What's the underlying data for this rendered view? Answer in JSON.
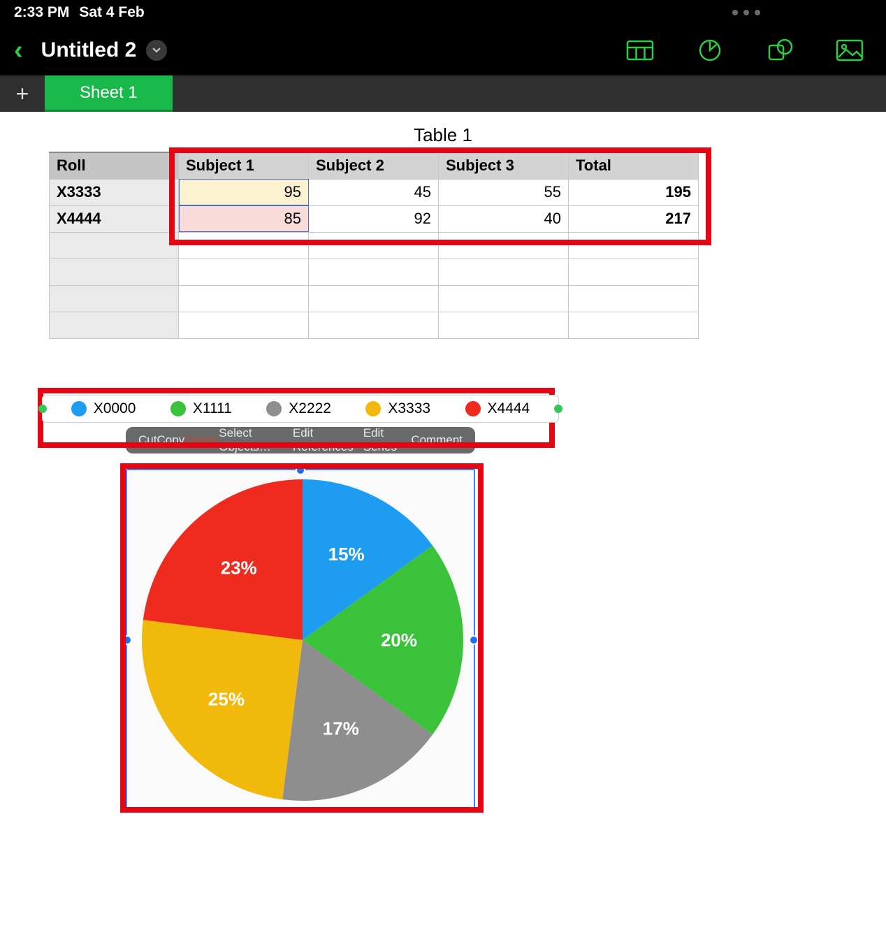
{
  "status": {
    "time": "2:33 PM",
    "date": "Sat 4 Feb"
  },
  "header": {
    "doc_title": "Untitled 2"
  },
  "tabs": {
    "active": "Sheet 1"
  },
  "table": {
    "title": "Table 1",
    "columns": [
      "Roll",
      "Subject 1",
      "Subject 2",
      "Subject 3",
      "Total"
    ],
    "rows": [
      {
        "roll": "X3333",
        "s1": "95",
        "s2": "45",
        "s3": "55",
        "total": "195"
      },
      {
        "roll": "X4444",
        "s1": "85",
        "s2": "92",
        "s3": "40",
        "total": "217"
      }
    ]
  },
  "legend": [
    {
      "label": "X0000",
      "color": "#1e9cf0"
    },
    {
      "label": "X1111",
      "color": "#3ac23a"
    },
    {
      "label": "X2222",
      "color": "#8e8e8e"
    },
    {
      "label": "X3333",
      "color": "#f2b90d"
    },
    {
      "label": "X4444",
      "color": "#ef2b20"
    }
  ],
  "context_menu": {
    "cut": "Cut",
    "copy": "Copy",
    "delete": "Delete",
    "select_objects": "Select Objects…",
    "edit_refs": "Edit References",
    "edit_series": "Edit Series",
    "comment": "Comment"
  },
  "chart_data": {
    "type": "pie",
    "title": "",
    "series": [
      {
        "name": "X0000",
        "value": 15,
        "label": "15%",
        "color": "#1e9cf0"
      },
      {
        "name": "X1111",
        "value": 20,
        "label": "20%",
        "color": "#3ac23a"
      },
      {
        "name": "X2222",
        "value": 17,
        "label": "17%",
        "color": "#8e8e8e"
      },
      {
        "name": "X3333",
        "value": 25,
        "label": "25%",
        "color": "#f2b90d"
      },
      {
        "name": "X4444",
        "value": 23,
        "label": "23%",
        "color": "#ef2b20"
      }
    ]
  }
}
